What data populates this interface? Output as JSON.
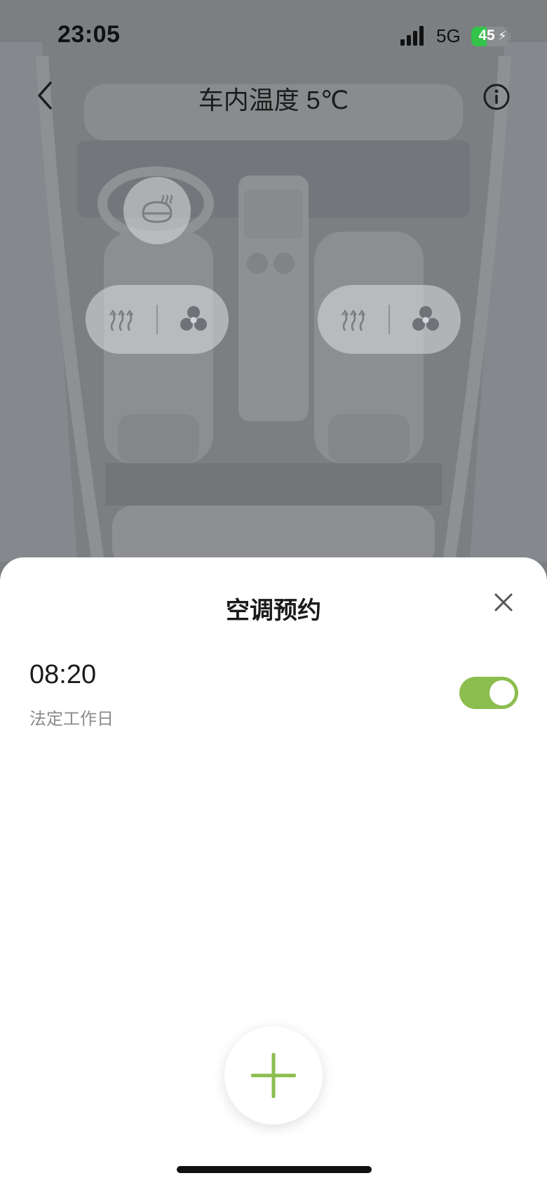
{
  "status_bar": {
    "time": "23:05",
    "network": "5G",
    "battery_level": "45",
    "battery_charging": true,
    "battery_color": "#33c24a"
  },
  "nav": {
    "back_icon": "chevron-left-icon",
    "title": "车内温度 5℃",
    "info_icon": "info-circle-icon"
  },
  "car_controls": {
    "steering_wheel_heat_icon": "steering-wheel-heat-icon",
    "seat_heat_icon": "seat-heat-icon",
    "seat_ventilation_icon": "fan-icon"
  },
  "sheet": {
    "title": "空调预约",
    "close_icon": "close-icon",
    "schedules": [
      {
        "time": "08:20",
        "repeat": "法定工作日",
        "enabled": true
      }
    ],
    "add_icon": "plus-icon",
    "accent_color": "#8cbd4f"
  }
}
